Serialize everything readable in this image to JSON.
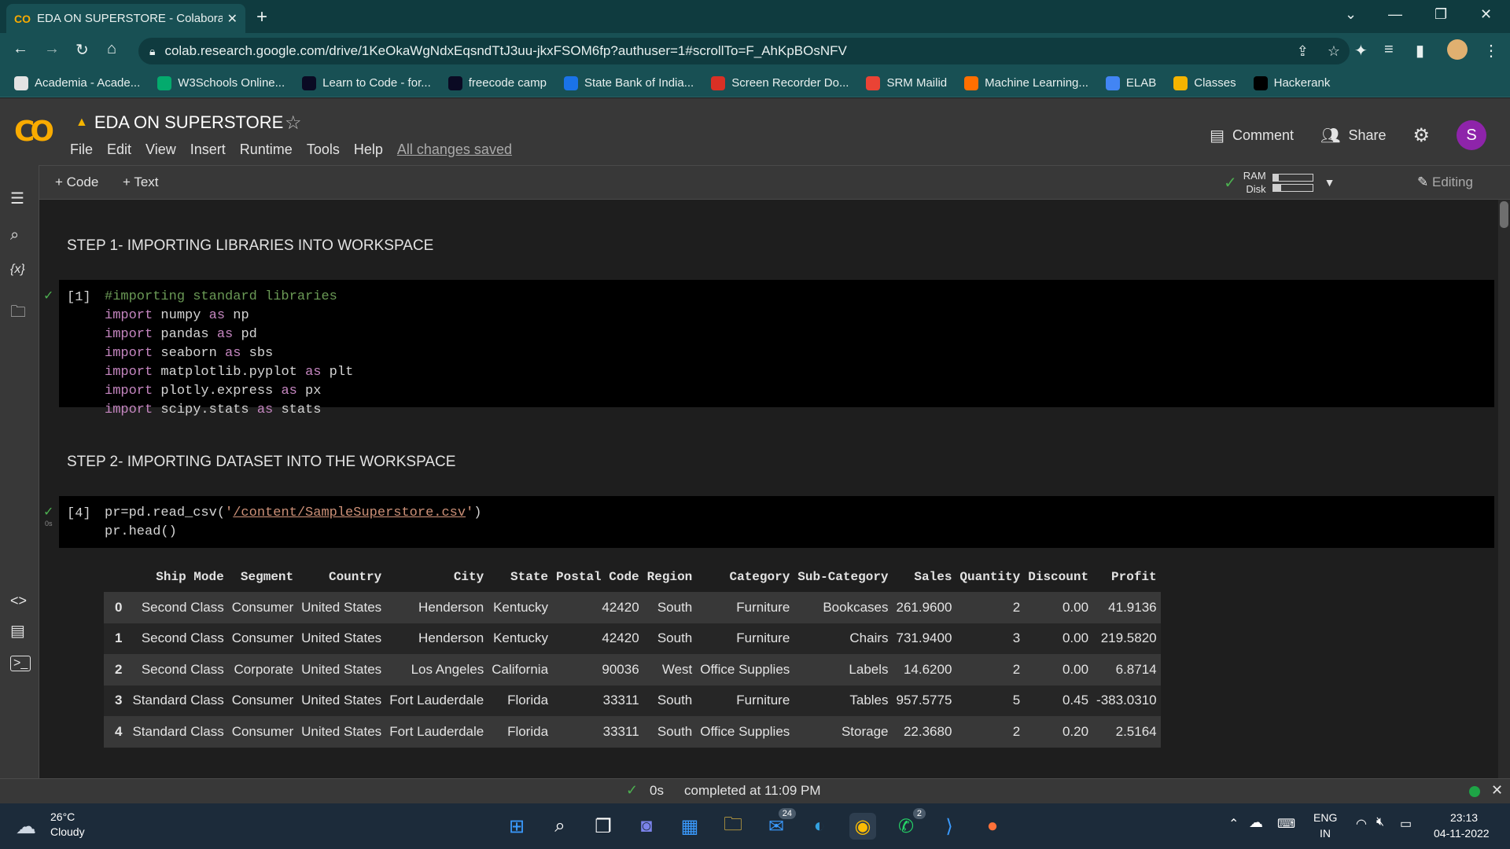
{
  "browser": {
    "tab_title": "EDA ON SUPERSTORE - Colabora",
    "tab_favicon": "CO",
    "url": "colab.research.google.com/drive/1KeOkaWgNdxEqsndTtJ3uu-jkxFSOM6fp?authuser=1#scrollTo=F_AhKpBOsNFV",
    "bookmarks": [
      {
        "label": "Academia - Acade...",
        "icon": "academia-icon",
        "color": "#e3e3e3"
      },
      {
        "label": "W3Schools Online...",
        "icon": "w3schools-icon",
        "color": "#04aa6d"
      },
      {
        "label": "Learn to Code - for...",
        "icon": "freecodecamp-icon",
        "color": "#0a0a23"
      },
      {
        "label": "freecode camp",
        "icon": "freecodecamp-icon",
        "color": "#0a0a23"
      },
      {
        "label": "State Bank of India...",
        "icon": "sbi-icon",
        "color": "#1a73e8"
      },
      {
        "label": "Screen Recorder Do...",
        "icon": "record-icon",
        "color": "#d93025"
      },
      {
        "label": "SRM Mailid",
        "icon": "gmail-icon",
        "color": "#ea4335"
      },
      {
        "label": "Machine Learning...",
        "icon": "ml-icon",
        "color": "#ff6f00"
      },
      {
        "label": "ELAB",
        "icon": "elab-icon",
        "color": "#4285f4"
      },
      {
        "label": "Classes",
        "icon": "classroom-icon",
        "color": "#f4b400"
      },
      {
        "label": "Hackerank",
        "icon": "hackerrank-icon",
        "color": "#000000"
      }
    ]
  },
  "colab": {
    "notebook_title": "EDA ON SUPERSTORE",
    "menus": [
      "File",
      "Edit",
      "View",
      "Insert",
      "Runtime",
      "Tools",
      "Help"
    ],
    "saved_status": "All changes saved",
    "comment_label": "Comment",
    "share_label": "Share",
    "avatar_letter": "S",
    "add_code": "+ Code",
    "add_text": "+ Text",
    "ram_label": "RAM",
    "disk_label": "Disk",
    "ram_usage": 0.15,
    "disk_usage": 0.2,
    "editing_label": "Editing"
  },
  "notebook": {
    "heading1": "STEP 1- IMPORTING LIBRARIES INTO WORKSPACE",
    "cell1": {
      "exec_count": "[1]",
      "comment": "#importing standard libraries",
      "imports": [
        {
          "kw": "import",
          "mod": " numpy ",
          "as": "as",
          "alias": " np"
        },
        {
          "kw": "import",
          "mod": " pandas ",
          "as": "as",
          "alias": " pd"
        },
        {
          "kw": "import",
          "mod": " seaborn ",
          "as": "as",
          "alias": " sbs"
        },
        {
          "kw": "import",
          "mod": " matplotlib.pyplot ",
          "as": "as",
          "alias": " plt"
        },
        {
          "kw": "import",
          "mod": " plotly.express ",
          "as": "as",
          "alias": " px"
        },
        {
          "kw": "import",
          "mod": " scipy.stats ",
          "as": "as",
          "alias": " stats"
        }
      ]
    },
    "heading2": "STEP 2- IMPORTING DATASET INTO THE WORKSPACE",
    "cell2": {
      "exec_count": "[4]",
      "exec_time": "0s",
      "line1_pre": "pr=pd.read_csv(",
      "line1_q1": "'",
      "line1_path": "/content/SampleSuperstore.csv",
      "line1_q2": "'",
      "line1_post": ")",
      "line2": "pr.head()"
    },
    "dataframe": {
      "columns": [
        "",
        "Ship Mode",
        "Segment",
        "Country",
        "City",
        "State",
        "Postal Code",
        "Region",
        "Category",
        "Sub-Category",
        "Sales",
        "Quantity",
        "Discount",
        "Profit"
      ],
      "rows": [
        [
          "0",
          "Second Class",
          "Consumer",
          "United States",
          "Henderson",
          "Kentucky",
          "42420",
          "South",
          "Furniture",
          "Bookcases",
          "261.9600",
          "2",
          "0.00",
          "41.9136"
        ],
        [
          "1",
          "Second Class",
          "Consumer",
          "United States",
          "Henderson",
          "Kentucky",
          "42420",
          "South",
          "Furniture",
          "Chairs",
          "731.9400",
          "3",
          "0.00",
          "219.5820"
        ],
        [
          "2",
          "Second Class",
          "Corporate",
          "United States",
          "Los Angeles",
          "California",
          "90036",
          "West",
          "Office Supplies",
          "Labels",
          "14.6200",
          "2",
          "0.00",
          "6.8714"
        ],
        [
          "3",
          "Standard Class",
          "Consumer",
          "United States",
          "Fort Lauderdale",
          "Florida",
          "33311",
          "South",
          "Furniture",
          "Tables",
          "957.5775",
          "5",
          "0.45",
          "-383.0310"
        ],
        [
          "4",
          "Standard Class",
          "Consumer",
          "United States",
          "Fort Lauderdale",
          "Florida",
          "33311",
          "South",
          "Office Supplies",
          "Storage",
          "22.3680",
          "2",
          "0.20",
          "2.5164"
        ]
      ]
    }
  },
  "status": {
    "time": "0s",
    "message": "completed at 11:09 PM"
  },
  "taskbar": {
    "weather_temp": "26°C",
    "weather_desc": "Cloudy",
    "mail_badge": "24",
    "whatsapp_badge": "2",
    "lang": "ENG",
    "region": "IN",
    "clock_time": "23:13",
    "clock_date": "04-11-2022"
  },
  "colors": {
    "accent_green": "#4caf50",
    "colab_orange": "#f9ab00",
    "browser_teal": "#185054"
  }
}
